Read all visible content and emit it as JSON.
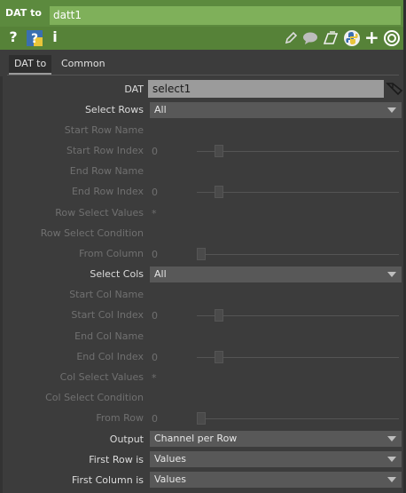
{
  "header": {
    "op_type": "DAT to",
    "op_name": "datt1",
    "icons": {
      "help": "?",
      "python_help": "?",
      "info": "i",
      "edit": "pencil-icon",
      "comment": "comment-icon",
      "clone": "clone-icon",
      "python": "python-icon",
      "add": "+",
      "viewer": "viewer-icon"
    }
  },
  "tabs": [
    {
      "label": "DAT to"
    },
    {
      "label": "Common"
    }
  ],
  "params": {
    "dat": {
      "label": "DAT",
      "value": "select1"
    },
    "select_rows": {
      "label": "Select Rows",
      "value": "All"
    },
    "start_row_name": {
      "label": "Start Row Name"
    },
    "start_row_index": {
      "label": "Start Row Index",
      "value": "0"
    },
    "end_row_name": {
      "label": "End Row  Name"
    },
    "end_row_index": {
      "label": "End Row Index",
      "value": "0"
    },
    "row_select_values": {
      "label": "Row Select Values",
      "value": "*"
    },
    "row_select_condition": {
      "label": "Row Select Condition"
    },
    "from_column": {
      "label": "From Column",
      "value": "0"
    },
    "select_cols": {
      "label": "Select Cols",
      "value": "All"
    },
    "start_col_name": {
      "label": "Start Col Name"
    },
    "start_col_index": {
      "label": "Start Col Index",
      "value": "0"
    },
    "end_col_name": {
      "label": "End Col Name"
    },
    "end_col_index": {
      "label": "End Col Index",
      "value": "0"
    },
    "col_select_values": {
      "label": "Col Select Values",
      "value": "*"
    },
    "col_select_condition": {
      "label": "Col Select Condition"
    },
    "from_row": {
      "label": "From Row",
      "value": "0"
    },
    "output": {
      "label": "Output",
      "value": "Channel per Row"
    },
    "first_row_is": {
      "label": "First Row is",
      "value": "Values"
    },
    "first_column_is": {
      "label": "First Column is",
      "value": "Values"
    }
  },
  "colors": {
    "header_green": "#5c8a3e",
    "name_field": "#7fb05a",
    "panel_bg": "#3c3c3c"
  }
}
